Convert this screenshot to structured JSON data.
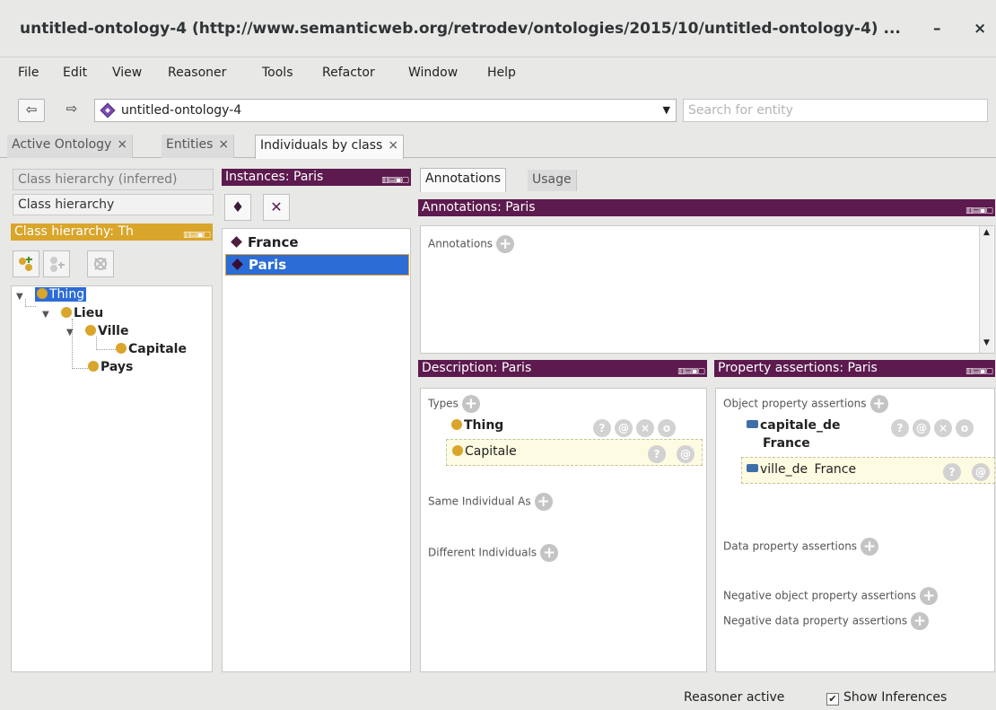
{
  "window": {
    "title": "untitled-ontology-4 (http://www.semanticweb.org/retrodev/ontologies/2015/10/untitled-ontology-4) ...",
    "minimize": "–",
    "close": "×"
  },
  "menu": [
    "File",
    "Edit",
    "View",
    "Reasoner",
    "Tools",
    "Refactor",
    "Window",
    "Help"
  ],
  "toolbar": {
    "back": "⇦",
    "forward": "⇨",
    "ontology": "untitled-ontology-4",
    "search_placeholder": "Search for entity"
  },
  "tabs": [
    {
      "label": "Active Ontology",
      "close": "×"
    },
    {
      "label": "Entities",
      "close": "×"
    },
    {
      "label": "Individuals by class",
      "close": "×"
    }
  ],
  "class_panel": {
    "inferred_label": "Class hierarchy (inferred)",
    "asserted_label": "Class hierarchy",
    "header": "Class hierarchy: Th",
    "tree": [
      {
        "label": "Thing"
      },
      {
        "label": "Lieu"
      },
      {
        "label": "Ville"
      },
      {
        "label": "Capitale"
      },
      {
        "label": "Pays"
      }
    ]
  },
  "instances_panel": {
    "header": "Instances: Paris",
    "items": [
      "France",
      "Paris"
    ]
  },
  "right_tabs": [
    "Annotations",
    "Usage"
  ],
  "annotations": {
    "header": "Annotations: Paris",
    "label": "Annotations"
  },
  "description": {
    "header": "Description: Paris",
    "types_label": "Types",
    "types": [
      "Thing",
      "Capitale"
    ],
    "same_label": "Same Individual As",
    "different_label": "Different Individuals"
  },
  "property_assertions": {
    "header": "Property assertions: Paris",
    "object_label": "Object property assertions",
    "object_items": [
      {
        "property": "capitale_de",
        "value": "France"
      },
      {
        "property": "ville_de",
        "value": "France"
      }
    ],
    "data_label": "Data property assertions",
    "neg_object_label": "Negative object property assertions",
    "neg_data_label": "Negative data property assertions"
  },
  "status": {
    "reasoner": "Reasoner active",
    "show_inferences": "Show Inferences",
    "show_inferences_checked": true
  },
  "colors": {
    "view_header": "#5c1a4e",
    "class_header": "#d9a52a",
    "selection": "#2c6cd6",
    "assertion_bg": "#fdfbe1"
  },
  "icons": {
    "class": "class-circle-icon",
    "individual": "individual-diamond-icon",
    "object_property": "object-property-icon",
    "add": "add-circle-icon"
  }
}
